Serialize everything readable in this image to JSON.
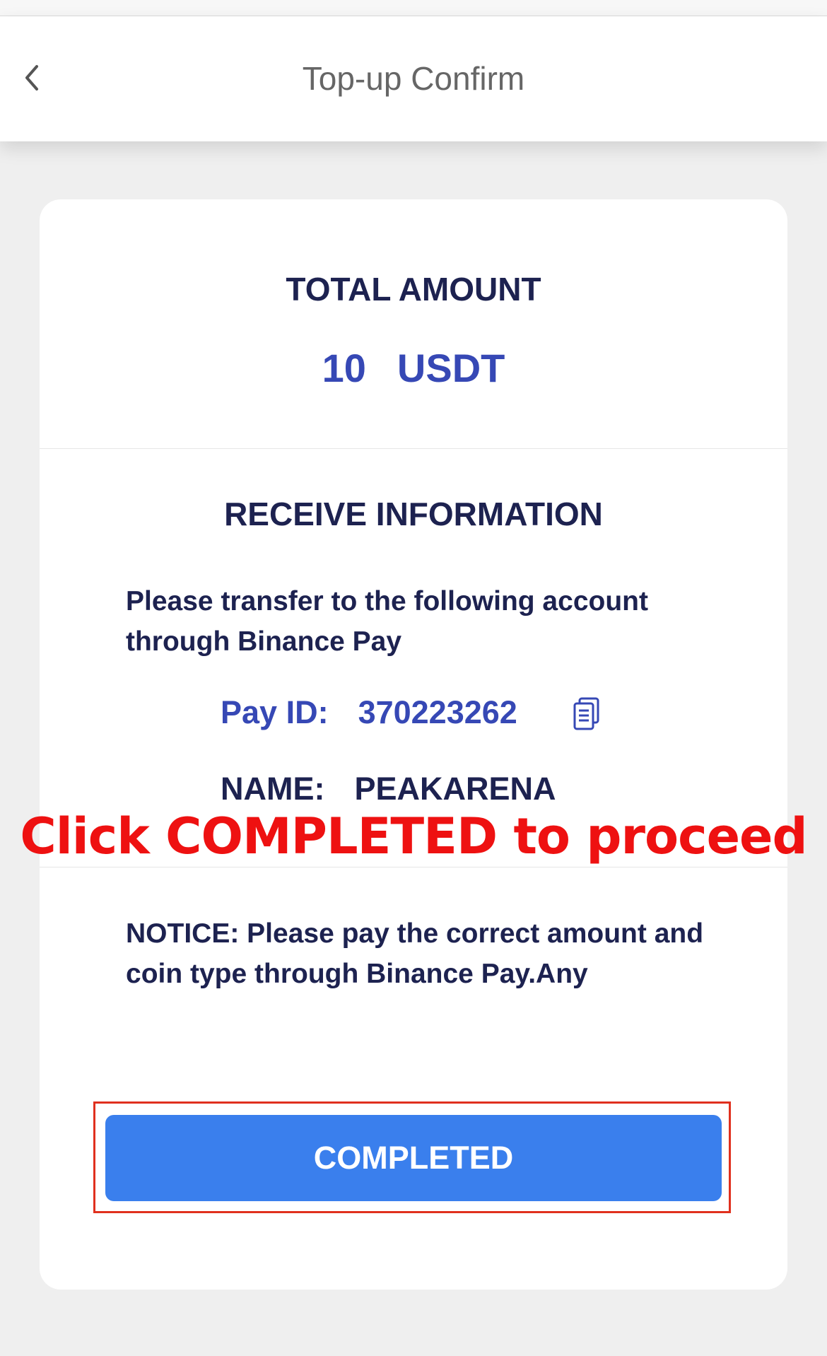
{
  "header": {
    "title": "Top-up Confirm",
    "back_icon": "chevron-left-icon"
  },
  "total": {
    "label": "TOTAL AMOUNT",
    "amount": "10",
    "currency": "USDT"
  },
  "receive": {
    "title": "RECEIVE INFORMATION",
    "instruction": "Please transfer to the following account through Binance Pay",
    "pay_id_label": "Pay ID:",
    "pay_id_value": "370223262",
    "copy_icon": "copy-icon",
    "name_label": "NAME:",
    "name_value": "PEAKARENA"
  },
  "notice": {
    "text": "NOTICE: Please pay the correct amount and coin type through Binance Pay.Any"
  },
  "overlay": {
    "instruction_text": "Click COMPLETED to proceed"
  },
  "actions": {
    "completed_label": "COMPLETED"
  },
  "colors": {
    "accent_blue": "#3648b5",
    "button_blue": "#3a7fed",
    "dark_text": "#1d2250",
    "overlay_red": "#ee1111",
    "background": "#efefef"
  }
}
